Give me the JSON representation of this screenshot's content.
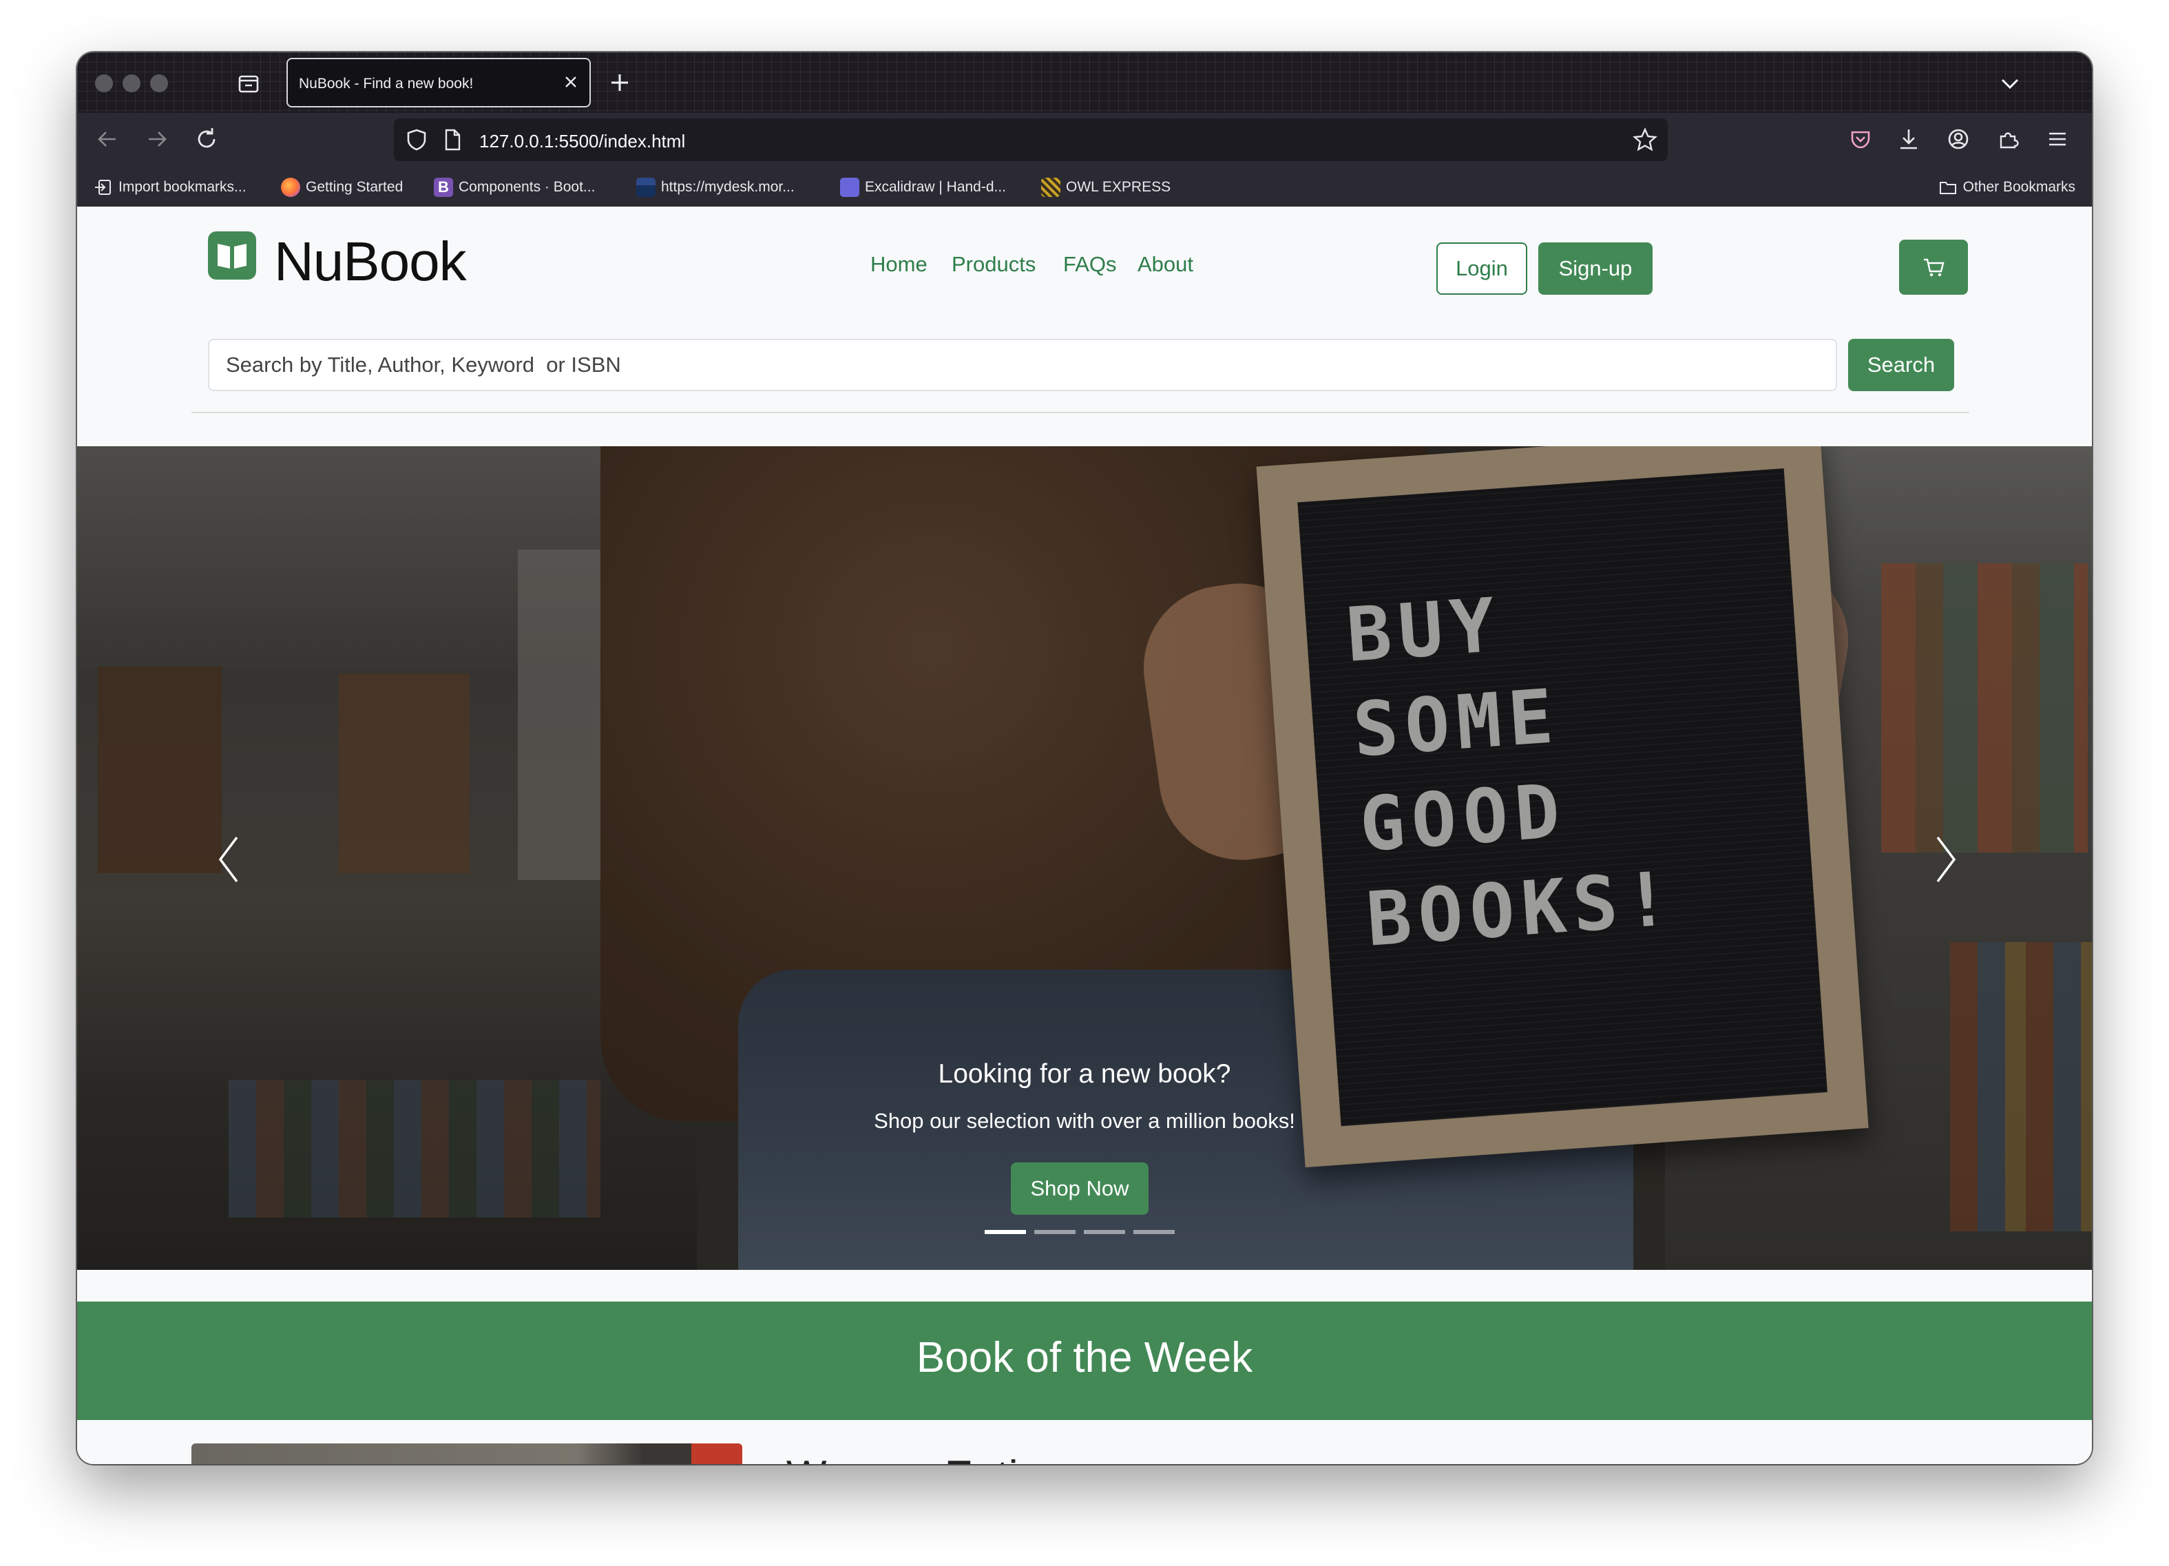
{
  "browser": {
    "tab_title": "NuBook - Find a new book!",
    "url": "127.0.0.1:5500/index.html",
    "bookmarks": [
      "Import bookmarks...",
      "Getting Started",
      "Components · Boot...",
      "https://mydesk.mor...",
      "Excalidraw | Hand-d...",
      "OWL EXPRESS"
    ],
    "other_bookmarks": "Other Bookmarks"
  },
  "header": {
    "brand": "NuBook",
    "nav": [
      "Home",
      "Products",
      "FAQs",
      "About"
    ],
    "login_label": "Login",
    "signup_label": "Sign-up",
    "search_placeholder": "Search by Title, Author, Keyword  or ISBN",
    "search_button": "Search"
  },
  "hero": {
    "board_text": "BUY\nSOME\nGOOD\nBOOKS!",
    "caption_title": "Looking for a new book?",
    "caption_text": "Shop our selection with over a million books!",
    "cta_label": "Shop Now",
    "slide_count": 4,
    "active_slide": 1
  },
  "book_of_week": {
    "heading": "Book of the Week",
    "title": "Women Eating"
  },
  "colors": {
    "brand_green": "#438956",
    "link_green": "#2e7d4a"
  }
}
